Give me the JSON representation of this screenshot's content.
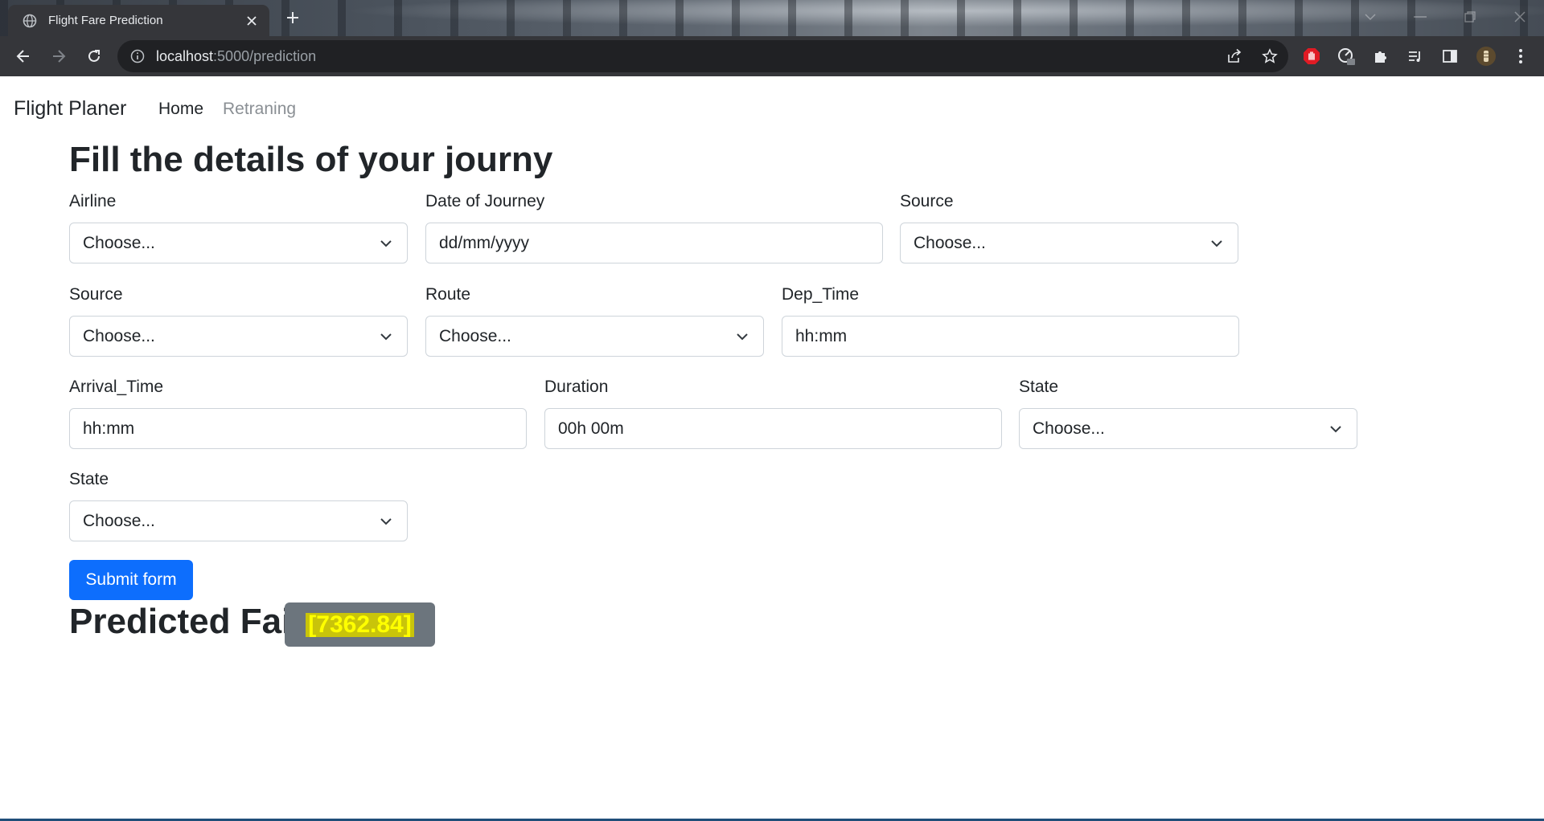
{
  "browser": {
    "tab_title": "Flight Fare Prediction",
    "url_host": "localhost",
    "url_path": ":5000/prediction"
  },
  "navbar": {
    "brand": "Flight Planer",
    "links": [
      "Home",
      "Retraning"
    ]
  },
  "form": {
    "title": "Fill the details of your journy",
    "fields": [
      {
        "label": "Airline",
        "value": "Choose...",
        "type": "select"
      },
      {
        "label": "Date of Journey",
        "placeholder": "dd/mm/yyyy",
        "type": "date"
      },
      {
        "label": "Source",
        "value": "Choose...",
        "type": "select"
      },
      {
        "label": "Source",
        "value": "Choose...",
        "type": "select"
      },
      {
        "label": "Route",
        "value": "Choose...",
        "type": "select"
      },
      {
        "label": "Dep_Time",
        "placeholder": "hh:mm",
        "type": "text"
      },
      {
        "label": "Arrival_Time",
        "placeholder": "hh:mm",
        "type": "text"
      },
      {
        "label": "Duration",
        "placeholder": "00h 00m",
        "type": "text"
      },
      {
        "label": "State",
        "value": "Choose...",
        "type": "select"
      },
      {
        "label": "State",
        "value": "Choose...",
        "type": "select"
      }
    ],
    "submit_label": "Submit form"
  },
  "result": {
    "label": "Predicted Fair",
    "value": "[7362.84]"
  },
  "colors": {
    "primary": "#0d6efd",
    "badge_bg": "#6c757d",
    "highlight_text": "#ffff00",
    "highlight_bg": "#c9c40a"
  }
}
